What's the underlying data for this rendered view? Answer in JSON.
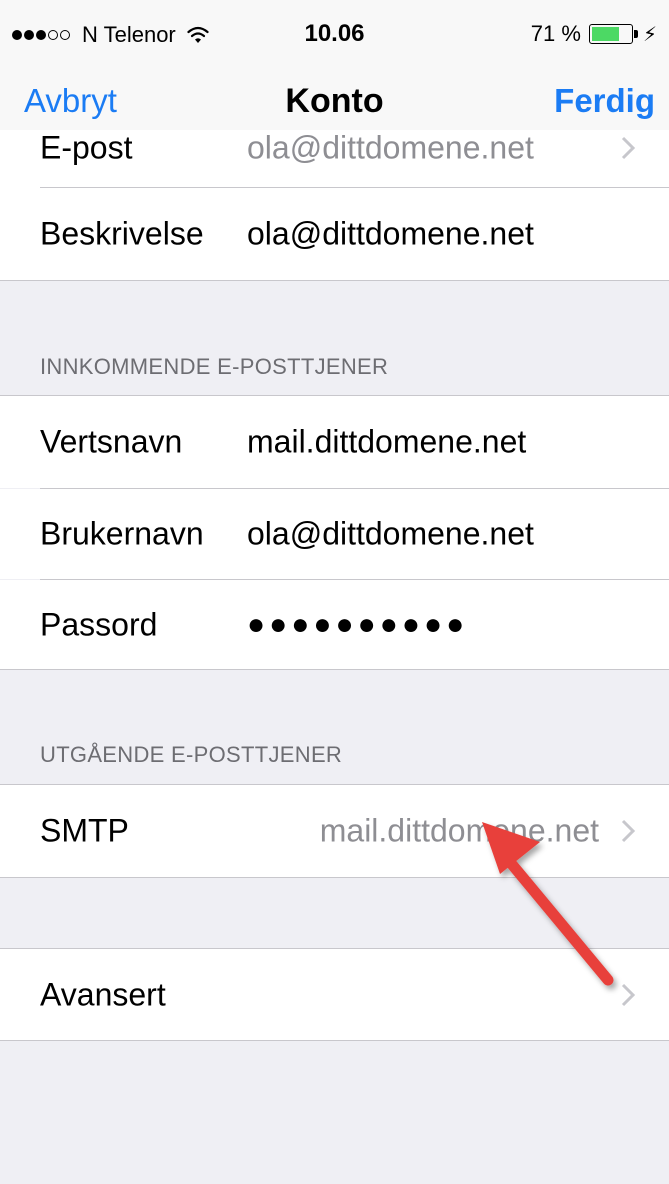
{
  "status_bar": {
    "carrier": "N Telenor",
    "time": "10.06",
    "battery_text": "71 %",
    "battery_level": 0.71,
    "signal_bars": 3
  },
  "nav": {
    "cancel": "Avbryt",
    "title": "Konto",
    "done": "Ferdig"
  },
  "account": {
    "email_label": "E-post",
    "email_value": "ola@dittdomene.net",
    "description_label": "Beskrivelse",
    "description_value": "ola@dittdomene.net"
  },
  "incoming": {
    "header": "INNKOMMENDE E-POSTTJENER",
    "host_label": "Vertsnavn",
    "host_value": "mail.dittdomene.net",
    "user_label": "Brukernavn",
    "user_value": "ola@dittdomene.net",
    "password_label": "Passord",
    "password_value": "●●●●●●●●●●"
  },
  "outgoing": {
    "header": "UTGÅENDE E-POSTTJENER",
    "smtp_label": "SMTP",
    "smtp_value": "mail.dittdomene.net"
  },
  "advanced": {
    "label": "Avansert"
  },
  "colors": {
    "accent": "#1b7cf4",
    "background": "#efeff4",
    "separator": "#c8c7cc",
    "annotation_arrow": "#e8403a"
  }
}
